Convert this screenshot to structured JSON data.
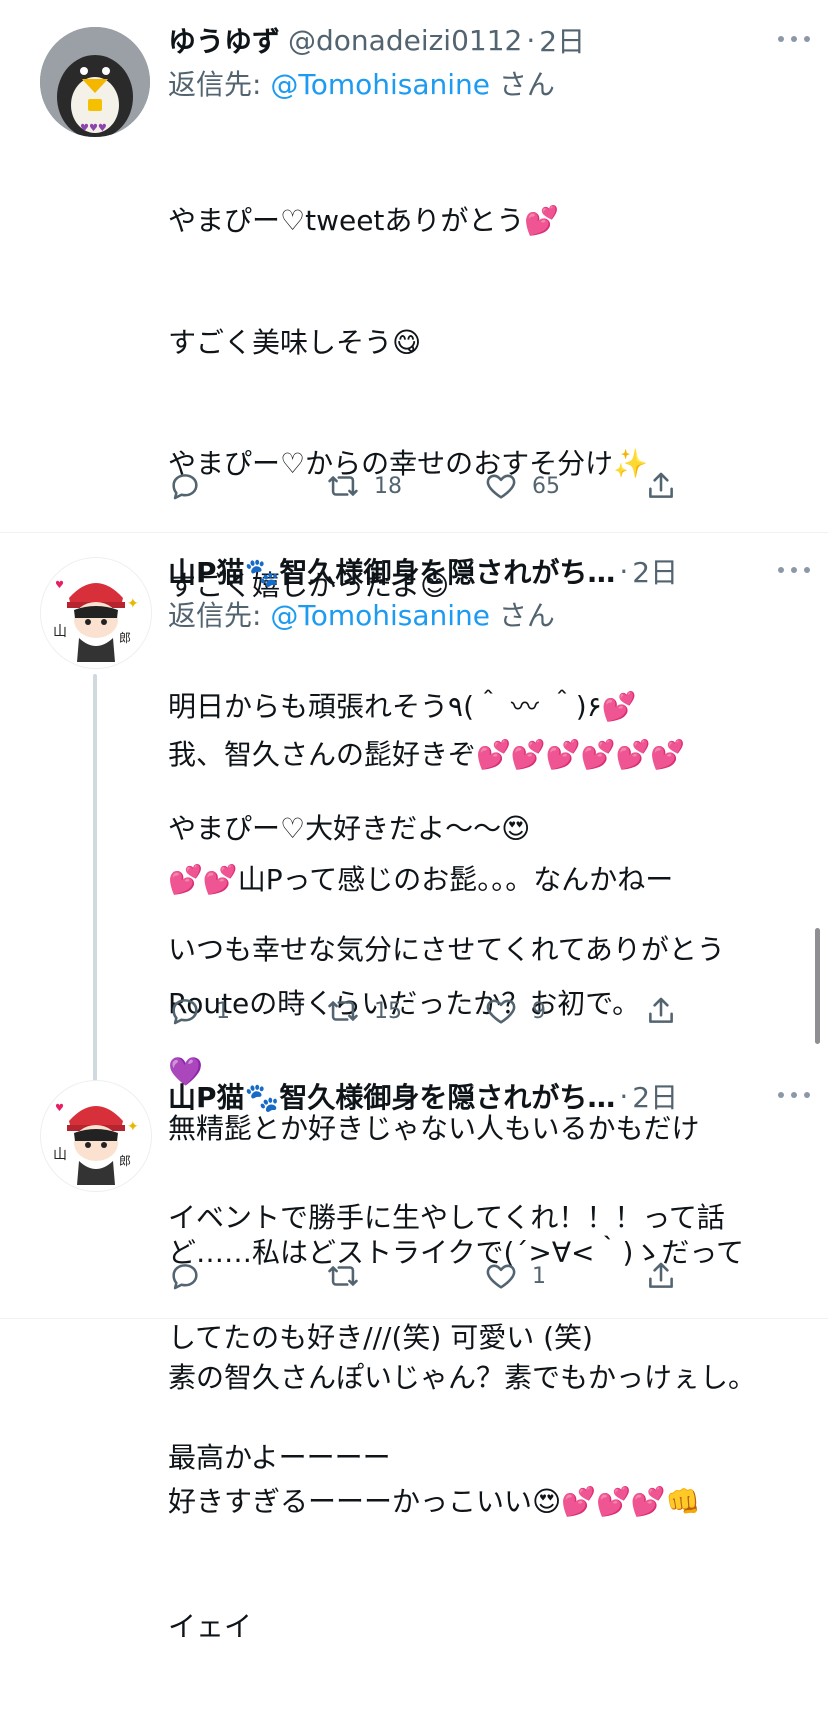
{
  "tweets": [
    {
      "name": "ゆうゆず",
      "handle": "@donadeizi0112",
      "dot": "·",
      "time": "2日",
      "reply_prefix": "返信先: ",
      "reply_mention": "@Tomohisanine",
      "reply_suffix": " さん",
      "body_lines": [
        "やまぴー♡tweetありがとう💕",
        "すごく美味しそう😋",
        "やまぴー♡からの幸せのおすそ分け✨",
        "すごく嬉しかったよ😊",
        "明日からも頑張れそう٩(＾ 〰 ＾)۶💕",
        "やまぴー♡大好きだよ〜〜😍",
        "いつも幸せな気分にさせてくれてありがとう",
        "💜"
      ],
      "replies": "",
      "retweets": "18",
      "likes": "65"
    },
    {
      "name": "山P猫🐾智久様御身を隠されがち…",
      "handle": "",
      "dot": "·",
      "time": "2日",
      "reply_prefix": "返信先: ",
      "reply_mention": "@Tomohisanine",
      "reply_suffix": " さん",
      "body_lines": [
        "我、智久さんの髭好きぞ💕💕💕💕💕💕",
        "💕💕山Pって感じのお髭。。。なんかねー",
        "Routeの時くらいだったか？お初で。",
        "無精髭とか好きじゃない人もいるかもだけ",
        "ど……私はどストライクで(´>∀<｀)ゝだって",
        "素の智久さんぽいじゃん？素でもかっけぇし。",
        "好きすぎるーーーかっこいい😍💕💕💕👊",
        "イェイ"
      ],
      "replies": "1",
      "retweets": "15",
      "likes": "9"
    },
    {
      "name": "山P猫🐾智久様御身を隠されがち…",
      "handle": "",
      "dot": "·",
      "time": "2日",
      "body_lines": [
        "イベントで勝手に生やしてくれ！！！って話",
        "してたのも好き///(笑) 可愛い (笑)",
        "最高かよーーーー"
      ],
      "replies": "",
      "retweets": "",
      "likes": "1"
    }
  ],
  "icons": {
    "reply": "reply-icon",
    "retweet": "retweet-icon",
    "like": "heart-icon",
    "share": "share-icon",
    "more": "more-icon"
  },
  "colors": {
    "link": "#1d9bf0",
    "secondary": "#536471",
    "text": "#0f1419"
  }
}
